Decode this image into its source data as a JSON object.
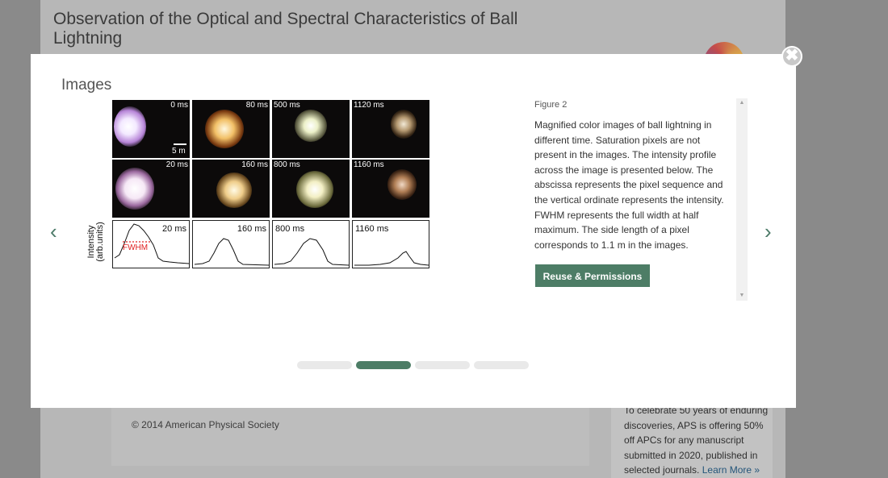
{
  "page": {
    "title": "Observation of the Optical and Spectral Characteristics of Ball Lightning",
    "copyright": "© 2014 American Physical Society",
    "promo_text": "To celebrate 50 years of enduring discoveries, APS is offering 50% off APCs for any manuscript submitted in 2020, published in selected journals.",
    "promo_link": "Learn More »"
  },
  "modal": {
    "heading": "Images",
    "close_glyph": "✖",
    "prev_glyph": "‹",
    "next_glyph": "›",
    "figure_label": "Figure 2",
    "figure_caption": "Magnified color images of ball lightning in different time. Saturation pixels are not present in the images. The intensity profile across the image is presented below. The abscissa represents the pixel sequence and the vertical ordinate represents the intensity. FWHM represents the full width at half maximum. The side length of a pixel corresponds to 1.1 m in the images.",
    "reuse_button": "Reuse & Permissions",
    "pagination": {
      "count": 4,
      "active_index": 1
    }
  },
  "figure": {
    "row1_labels": [
      "0 ms",
      "80 ms",
      "500 ms",
      "1120 ms"
    ],
    "row2_labels": [
      "20 ms",
      "160 ms",
      "800 ms",
      "1160 ms"
    ],
    "plot_labels": [
      "20 ms",
      "160 ms",
      "800 ms",
      "1160 ms"
    ],
    "scale_label": "5 m",
    "fwhm_label": "FWHM",
    "ylabel_line1": "Intensity",
    "ylabel_line2": "(arb.units)",
    "scroll_up_glyph": "▲",
    "scroll_down_glyph": "▼"
  }
}
